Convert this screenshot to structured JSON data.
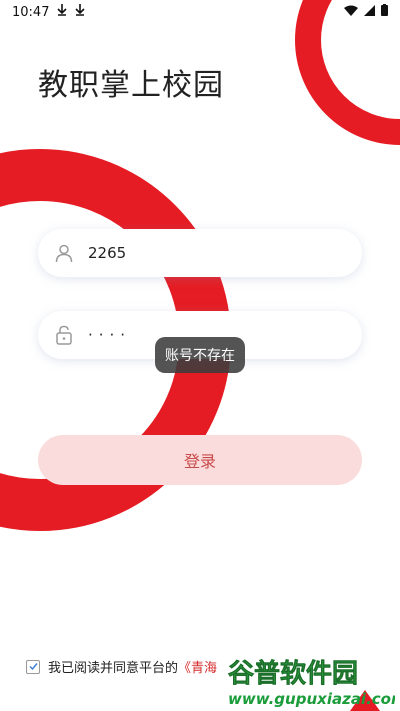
{
  "status_bar": {
    "time": "10:47"
  },
  "app": {
    "title": "教职掌上校园"
  },
  "login_form": {
    "username_value": "2265",
    "password_masked": "····"
  },
  "toast": {
    "message": "账号不存在"
  },
  "login_button": {
    "label": "登录"
  },
  "agreement": {
    "checked": true,
    "prefix": "我已阅读并同意平台的",
    "link_text": "《青海"
  },
  "watermark": {
    "brand": "谷普软件园",
    "url": "www.gupuxiazai.com"
  },
  "colors": {
    "brand_red": "#e51c23",
    "button_bg": "#fbdcdc",
    "button_text": "#c94a4a"
  }
}
